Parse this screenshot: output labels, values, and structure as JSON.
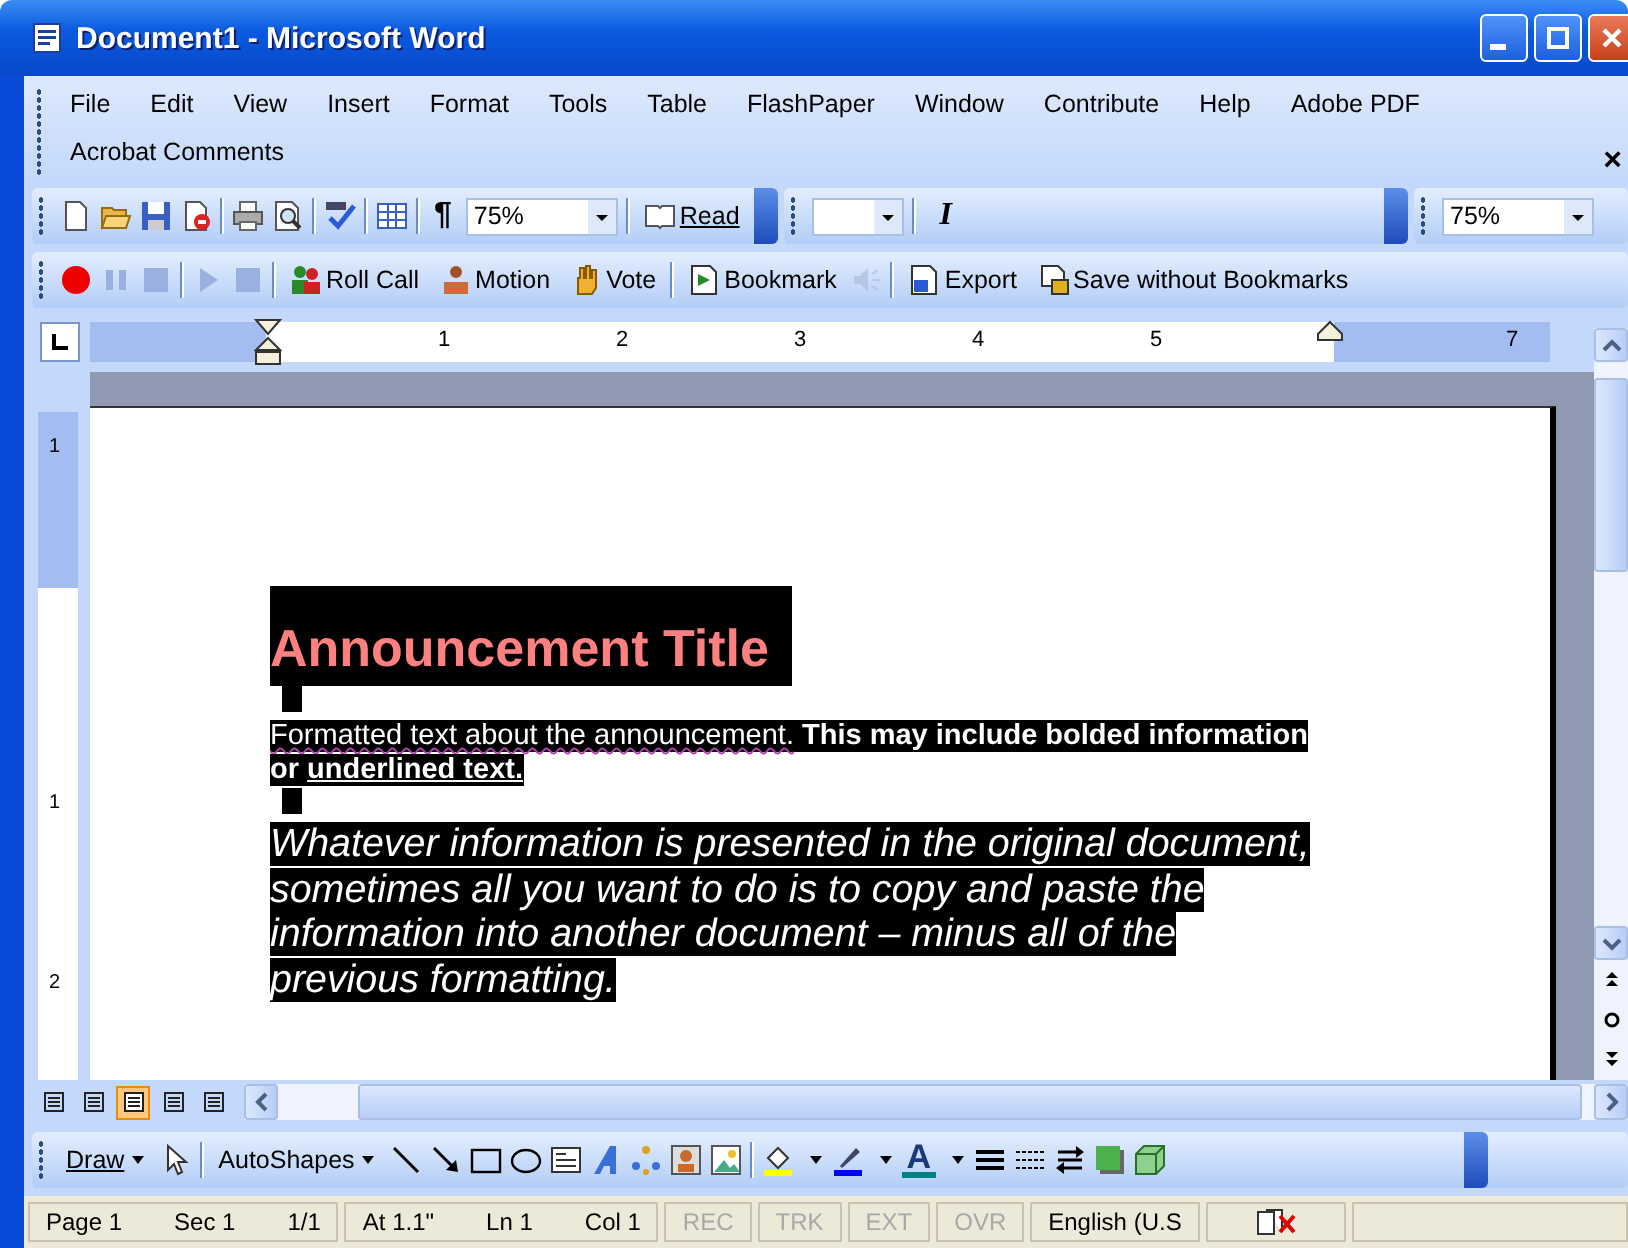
{
  "window": {
    "title": "Document1 - Microsoft Word"
  },
  "menu": {
    "items": [
      {
        "label": "File"
      },
      {
        "label": "Edit"
      },
      {
        "label": "View"
      },
      {
        "label": "Insert"
      },
      {
        "label": "Format"
      },
      {
        "label": "Tools"
      },
      {
        "label": "Table"
      },
      {
        "label": "FlashPaper"
      },
      {
        "label": "Window"
      },
      {
        "label": "Contribute"
      },
      {
        "label": "Help"
      },
      {
        "label": "Adobe PDF"
      },
      {
        "label": "Acrobat Comments"
      }
    ],
    "close": "×"
  },
  "standard_toolbar": {
    "pilcrow": "¶",
    "zoom": "75%",
    "read": "Read"
  },
  "formatting_toolbar": {
    "italic": "I",
    "zoom": "75%"
  },
  "second_toolbar": {
    "items": [
      {
        "label": "Roll Call"
      },
      {
        "label": "Motion"
      },
      {
        "label": "Vote"
      },
      {
        "label": "Bookmark"
      },
      {
        "label": "Export"
      },
      {
        "label": "Save without Bookmarks"
      }
    ]
  },
  "ruler": {
    "numbers": [
      "1",
      "2",
      "3",
      "4",
      "5",
      "7"
    ]
  },
  "vertical_ruler": {
    "numbers": [
      "1",
      "1",
      "2"
    ]
  },
  "document": {
    "title": "Announcement Title",
    "paragraphs": [
      {
        "runs": [
          {
            "text": "Formatted text about the announcement.",
            "bold": false,
            "underline": false,
            "flagged": true
          },
          {
            "text": " This may include bolded information or ",
            "bold": true,
            "underline": false,
            "flagged": false
          },
          {
            "text": "underlined text.",
            "bold": true,
            "underline": true,
            "flagged": false
          }
        ]
      },
      {
        "runs": [
          {
            "text": "Whatever information is presented in the original document, sometimes all you want to do is to copy and paste the information into another document – minus all of the previous formatting.",
            "bold": false,
            "underline": false,
            "flagged": false
          }
        ]
      }
    ]
  },
  "view_buttons": [
    {
      "selected": false
    },
    {
      "selected": false
    },
    {
      "selected": true
    },
    {
      "selected": false
    },
    {
      "selected": false
    }
  ],
  "drawing_toolbar": {
    "draw": "Draw",
    "autoshapes": "AutoShapes",
    "font_color": "A"
  },
  "status_bar": {
    "groups": [
      {
        "items": [
          {
            "text": "Page 1",
            "disabled": false
          },
          {
            "text": "Sec 1",
            "disabled": false
          },
          {
            "text": "1/1",
            "disabled": false
          }
        ]
      },
      {
        "items": [
          {
            "text": "At 1.1\"",
            "disabled": false
          },
          {
            "text": "Ln 1",
            "disabled": false
          },
          {
            "text": "Col 1",
            "disabled": false
          }
        ]
      },
      {
        "items": [
          {
            "text": "REC",
            "disabled": true
          }
        ]
      },
      {
        "items": [
          {
            "text": "TRK",
            "disabled": true
          }
        ]
      },
      {
        "items": [
          {
            "text": "EXT",
            "disabled": true
          }
        ]
      },
      {
        "items": [
          {
            "text": "OVR",
            "disabled": true
          }
        ]
      },
      {
        "items": [
          {
            "text": "English (U.S",
            "disabled": false
          }
        ]
      }
    ]
  }
}
